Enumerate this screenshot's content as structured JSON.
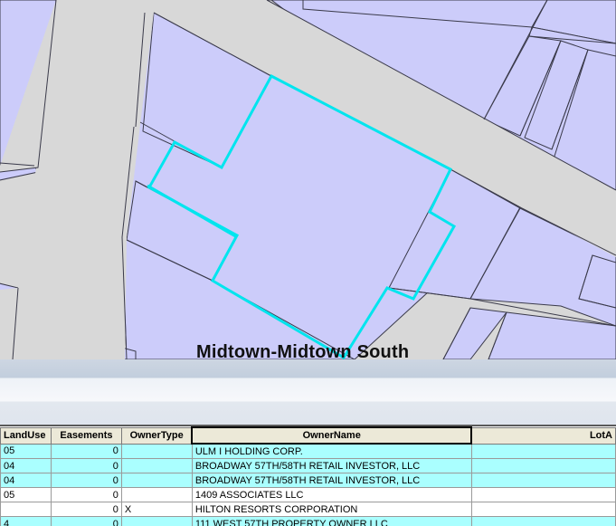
{
  "map": {
    "label": "Midtown-Midtown South",
    "colors": {
      "background": "#d8d8d8",
      "parcel_fill": "#ccccfa",
      "parcel_stroke": "#3a3a4a",
      "selection": "#00e5ee"
    }
  },
  "grid": {
    "columns": [
      "LandUse",
      "Easements",
      "OwnerType",
      "OwnerName",
      "LotA"
    ],
    "selected_column": "OwnerName",
    "rows": [
      {
        "landuse": "05",
        "easements": "0",
        "ownertype": "",
        "ownername": "ULM I HOLDING CORP.",
        "lota": "",
        "highlighted": true
      },
      {
        "landuse": "04",
        "easements": "0",
        "ownertype": "",
        "ownername": "BROADWAY 57TH/58TH RETAIL INVESTOR, LLC",
        "lota": "",
        "highlighted": true
      },
      {
        "landuse": "04",
        "easements": "0",
        "ownertype": "",
        "ownername": "BROADWAY 57TH/58TH RETAIL INVESTOR, LLC",
        "lota": "",
        "highlighted": true
      },
      {
        "landuse": "05",
        "easements": "0",
        "ownertype": "",
        "ownername": "1409 ASSOCIATES LLC",
        "lota": "",
        "highlighted": false
      },
      {
        "landuse": "",
        "easements": "0",
        "ownertype": "X",
        "ownername": "HILTON RESORTS CORPORATION",
        "lota": "",
        "highlighted": false
      },
      {
        "landuse": "4",
        "easements": "0",
        "ownertype": "",
        "ownername": "111 WEST 57TH PROPERTY OWNER LLC",
        "lota": "",
        "highlighted": true
      }
    ]
  }
}
